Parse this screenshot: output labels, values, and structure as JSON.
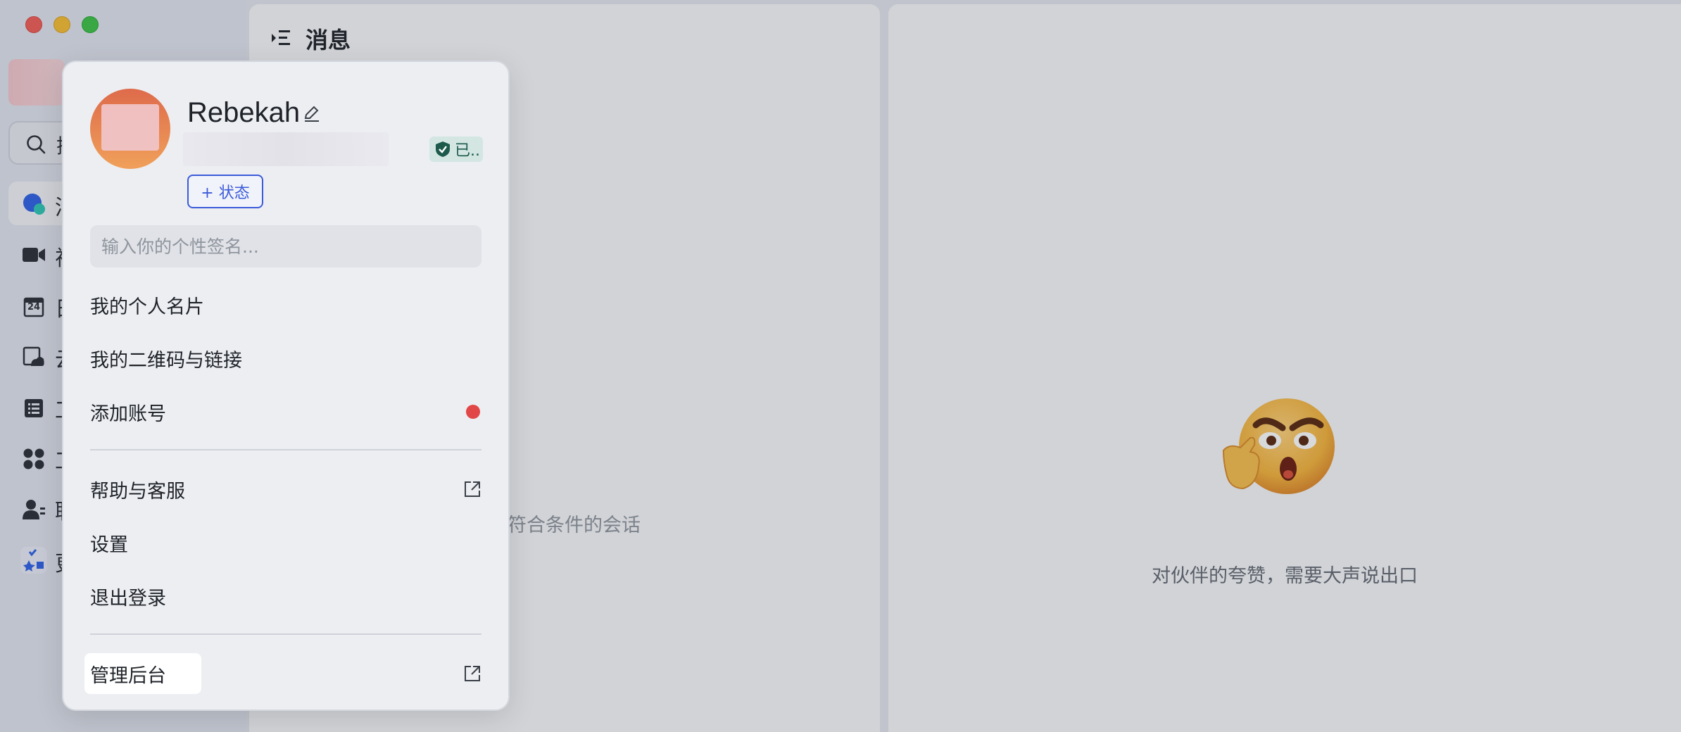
{
  "sidebar": {
    "search_glyph": "搜",
    "items": [
      {
        "icon": "chat-bubble-icon",
        "glyph": "消"
      },
      {
        "icon": "video-icon",
        "glyph": "视"
      },
      {
        "icon": "calendar-icon",
        "glyph": "日",
        "calendar_day": "24"
      },
      {
        "icon": "cloud-docs-icon",
        "glyph": "云"
      },
      {
        "icon": "list-icon",
        "glyph": "工"
      },
      {
        "icon": "apps-grid-icon",
        "glyph": "工"
      },
      {
        "icon": "contacts-icon",
        "glyph": "联"
      },
      {
        "icon": "workplace-icon",
        "glyph": "更"
      }
    ]
  },
  "messages": {
    "title": "消息",
    "empty_text": "无符合条件的会话"
  },
  "right_panel": {
    "text": "对伙伴的夸赞，需要大声说出口"
  },
  "profile_card": {
    "name": "Rebekah",
    "verified_label": "已..",
    "status_button": "+ 状态",
    "signature_placeholder": "输入你的个性签名...",
    "menu": {
      "personal_card": "我的个人名片",
      "qr_code": "我的二维码与链接",
      "add_account": "添加账号",
      "help": "帮助与客服",
      "settings": "设置",
      "logout": "退出登录",
      "admin": "管理后台"
    }
  },
  "colors": {
    "accent": "#3b5bd9",
    "notify_dot": "#e24747",
    "verified_bg": "#d4e6e2"
  }
}
